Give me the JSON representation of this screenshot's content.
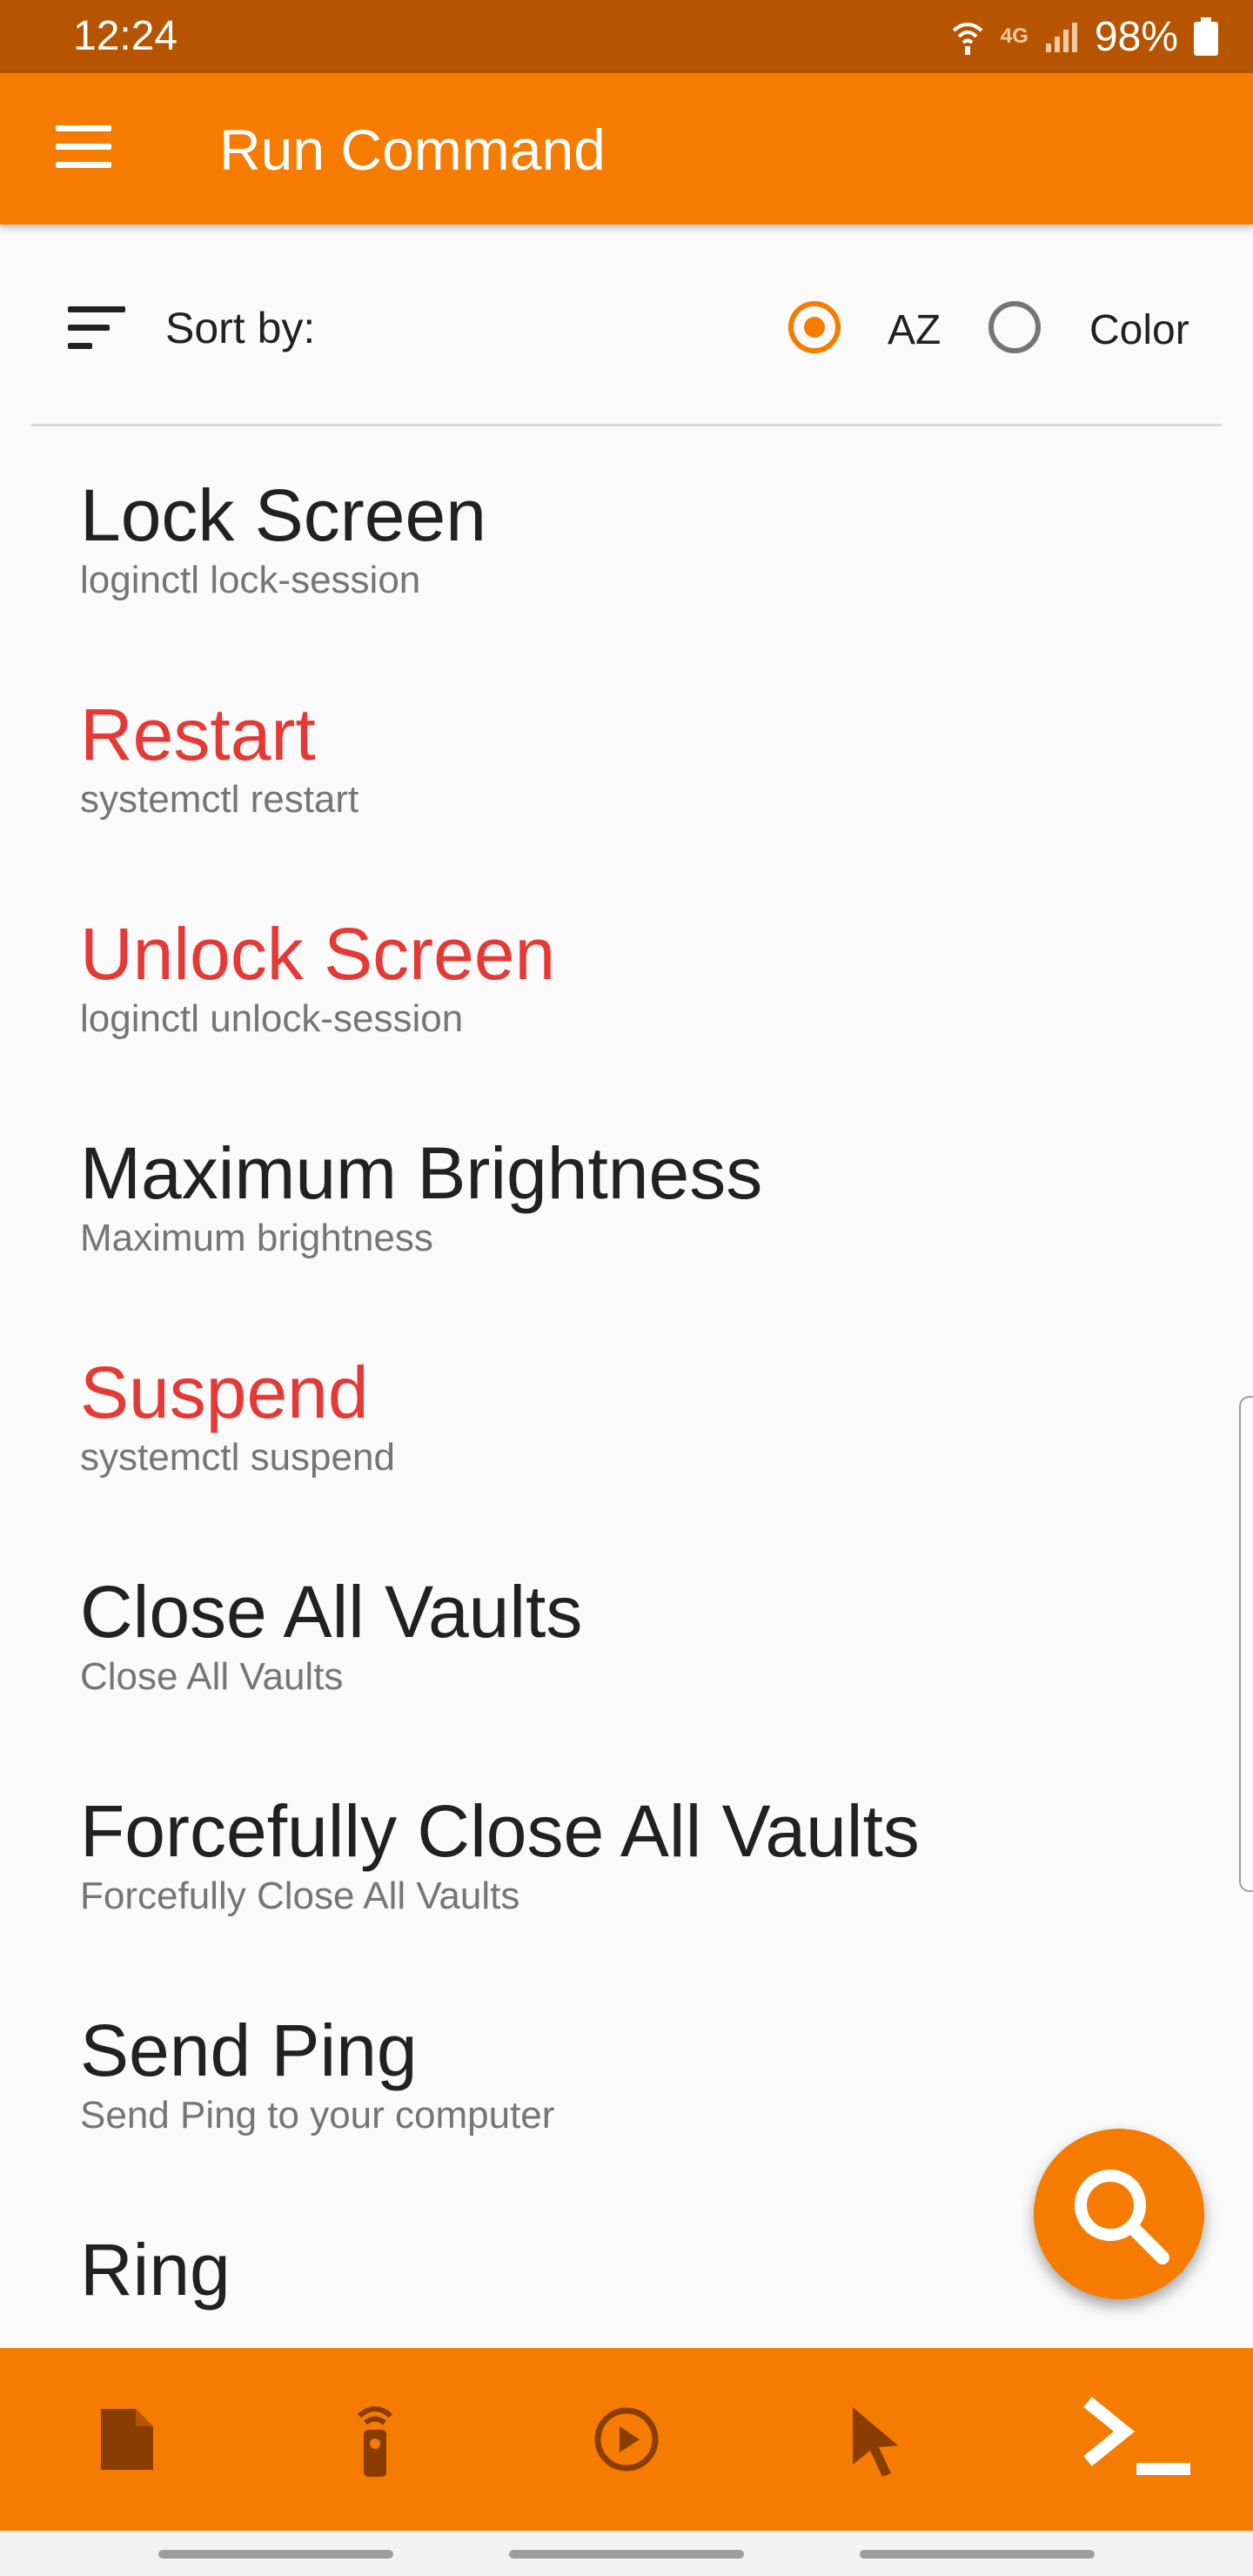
{
  "status_bar": {
    "time": "12:24",
    "network": "4G",
    "battery": "98%"
  },
  "app_bar": {
    "title": "Run Command",
    "menu_icon": "hamburger-menu-icon"
  },
  "sort": {
    "label": "Sort by:",
    "options": [
      {
        "label": "AZ",
        "selected": true
      },
      {
        "label": "Color",
        "selected": false
      }
    ]
  },
  "commands": [
    {
      "name": "Lock Screen",
      "command": "loginctl lock-session",
      "color": "#212121"
    },
    {
      "name": "Restart",
      "command": "systemctl restart",
      "color": "#e53935"
    },
    {
      "name": "Unlock Screen",
      "command": "loginctl unlock-session",
      "color": "#e53935"
    },
    {
      "name": "Maximum Brightness",
      "command": "Maximum brightness",
      "color": "#212121"
    },
    {
      "name": "Suspend",
      "command": "systemctl suspend",
      "color": "#e53935"
    },
    {
      "name": "Close All Vaults",
      "command": "Close All Vaults",
      "color": "#212121"
    },
    {
      "name": "Forcefully Close All Vaults",
      "command": "Forcefully Close All Vaults",
      "color": "#212121"
    },
    {
      "name": "Send Ping",
      "command": "Send Ping to your computer",
      "color": "#212121"
    },
    {
      "name": "Ring",
      "command": "",
      "color": "#212121"
    }
  ],
  "fab": {
    "icon": "search-icon"
  },
  "bottom_nav": [
    {
      "icon": "file-icon"
    },
    {
      "icon": "remote-icon"
    },
    {
      "icon": "play-circle-icon"
    },
    {
      "icon": "cursor-icon"
    },
    {
      "icon": "terminal-icon",
      "active": true
    }
  ],
  "colors": {
    "accent": "#f57c00",
    "status_bar": "#b65400",
    "highlight_red": "#e53935",
    "inactive_icon": "#8a3d00"
  }
}
